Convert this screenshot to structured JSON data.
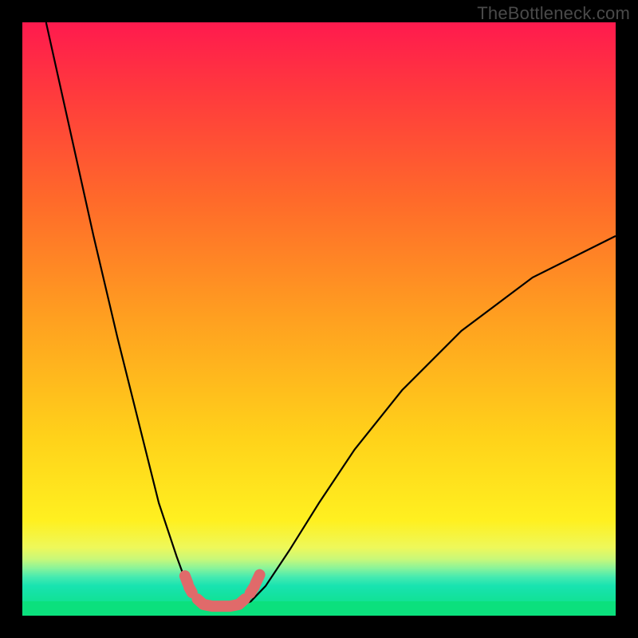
{
  "watermark": "TheBottleneck.com",
  "chart_data": {
    "type": "line",
    "title": "",
    "xlabel": "",
    "ylabel": "",
    "xlim": [
      0,
      100
    ],
    "ylim": [
      0,
      100
    ],
    "grid": false,
    "legend": false,
    "background": {
      "type": "vertical-gradient",
      "stops": [
        {
          "pos": 0,
          "color": "#ff1a4e"
        },
        {
          "pos": 0.5,
          "color": "#ffa020"
        },
        {
          "pos": 0.84,
          "color": "#fff020"
        },
        {
          "pos": 0.93,
          "color": "#45eab0"
        },
        {
          "pos": 1.0,
          "color": "#0be07d"
        }
      ]
    },
    "series": [
      {
        "name": "left-arm",
        "color": "#000000",
        "width": 2.2,
        "x": [
          4,
          8,
          12,
          16,
          20,
          23,
          26,
          28,
          29.5,
          30.5
        ],
        "y": [
          100,
          82,
          64,
          47,
          31,
          19,
          10,
          4.5,
          2.3,
          1.8
        ]
      },
      {
        "name": "right-arm",
        "color": "#000000",
        "width": 2.2,
        "x": [
          37,
          38.5,
          41,
          45,
          50,
          56,
          64,
          74,
          86,
          100
        ],
        "y": [
          1.8,
          2.4,
          5,
          11,
          19,
          28,
          38,
          48,
          57,
          64
        ]
      },
      {
        "name": "trough-thick",
        "color": "#e06a6a",
        "width": 14,
        "linecap": "round",
        "x": [
          29.5,
          30.5,
          32,
          33.5,
          35,
          36.5,
          37.5
        ],
        "y": [
          2.8,
          1.9,
          1.6,
          1.6,
          1.6,
          1.9,
          2.8
        ]
      },
      {
        "name": "left-bead-upper",
        "color": "#e06a6a",
        "width": 14,
        "linecap": "round",
        "x": [
          27.4,
          27.9
        ],
        "y": [
          6.7,
          5.4
        ]
      },
      {
        "name": "left-bead-lower",
        "color": "#e06a6a",
        "width": 14,
        "linecap": "round",
        "x": [
          28.1,
          28.6
        ],
        "y": [
          4.8,
          3.9
        ]
      },
      {
        "name": "right-bead-lower",
        "color": "#e06a6a",
        "width": 14,
        "linecap": "round",
        "x": [
          38.4,
          39.1
        ],
        "y": [
          3.8,
          4.9
        ]
      },
      {
        "name": "right-bead-upper",
        "color": "#e06a6a",
        "width": 14,
        "linecap": "round",
        "x": [
          39.3,
          40.0
        ],
        "y": [
          5.4,
          6.9
        ]
      }
    ]
  }
}
